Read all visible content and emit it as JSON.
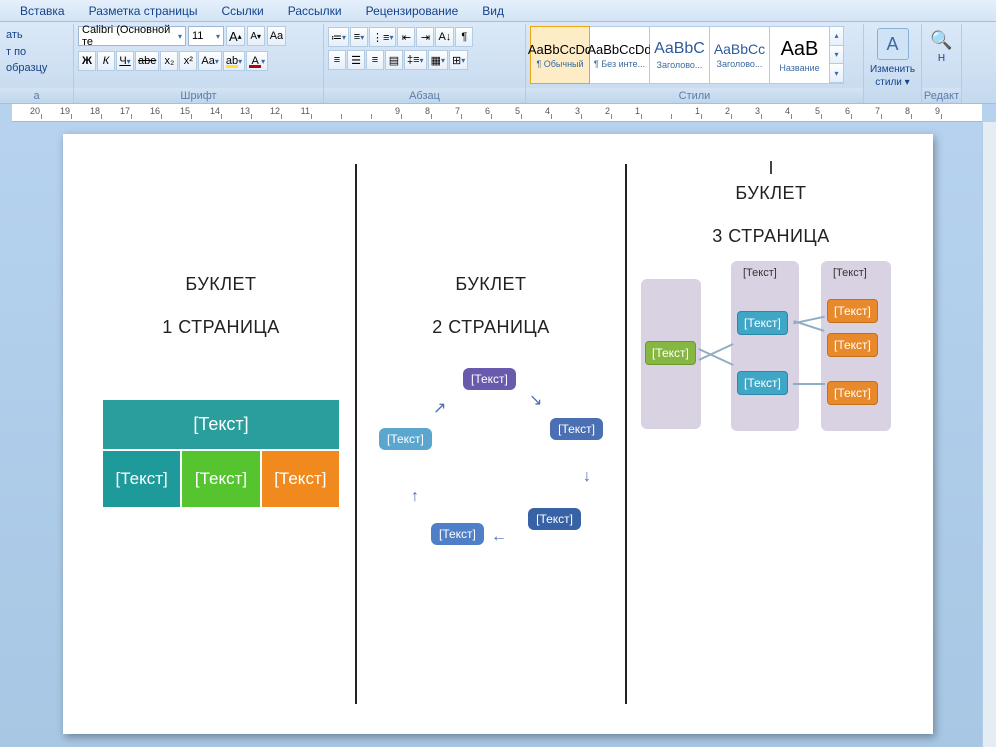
{
  "menu": {
    "insert": "Вставка",
    "layout": "Разметка страницы",
    "links": "Ссылки",
    "mail": "Рассылки",
    "review": "Рецензирование",
    "view": "Вид"
  },
  "clipboard": {
    "line1": "ать",
    "line2": "т по образцу",
    "line3": "а"
  },
  "font": {
    "name": "Calibri (Основной те",
    "size": "11",
    "bold": "Ж",
    "italic": "К",
    "underline": "Ч",
    "strike": "abe",
    "sub": "x₂",
    "sup": "x²",
    "case": "Aa",
    "grow": "A",
    "shrink": "A",
    "clear": "Aa",
    "highlight": "ab",
    "color": "A",
    "group": "Шрифт"
  },
  "paragraph": {
    "group": "Абзац"
  },
  "styles": {
    "group": "Стили",
    "items": [
      {
        "preview": "AaBbCcDd",
        "name": "¶ Обычный",
        "sel": true
      },
      {
        "preview": "AaBbCcDd",
        "name": "¶ Без инте...",
        "sel": false
      },
      {
        "preview": "AaBbC",
        "name": "Заголово...",
        "sel": false
      },
      {
        "preview": "AaBbCc",
        "name": "Заголово...",
        "sel": false
      },
      {
        "preview": "AaB",
        "name": "Название",
        "sel": false
      }
    ],
    "change": "Изменить",
    "change2": "стили ▾"
  },
  "editing": {
    "group": "Редакт",
    "find": "Н"
  },
  "doc": {
    "p1": {
      "title": "БУКЛЕТ",
      "sub": "1 СТРАНИЦА"
    },
    "p2": {
      "title": "БУКЛЕТ",
      "sub": "2 СТРАНИЦА"
    },
    "p3": {
      "pre": "I",
      "title": "БУКЛЕТ",
      "sub": "3 СТРАНИЦА"
    },
    "placeholder": "[Текст]"
  },
  "ruler": {
    "marks": [
      "20",
      "19",
      "18",
      "17",
      "16",
      "15",
      "14",
      "13",
      "12",
      "11",
      "",
      "",
      "9",
      "8",
      "7",
      "6",
      "5",
      "4",
      "3",
      "2",
      "1",
      "",
      "1",
      "2",
      "3",
      "4",
      "5",
      "6",
      "7",
      "8",
      "9"
    ]
  }
}
